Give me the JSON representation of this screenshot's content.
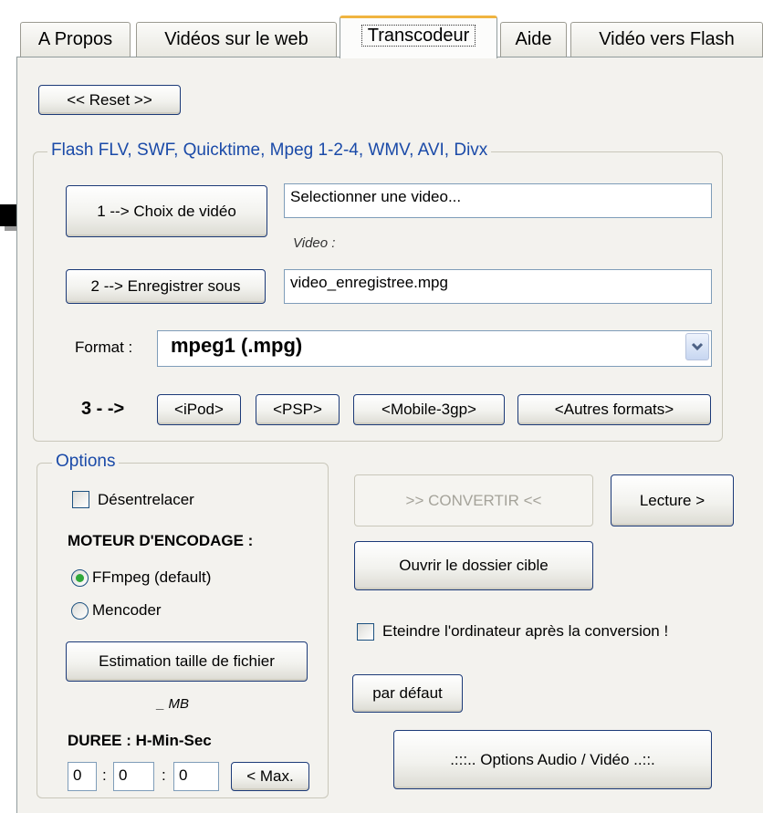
{
  "tabs": [
    {
      "label": "A Propos",
      "active": false
    },
    {
      "label": "Vidéos sur le web",
      "active": false
    },
    {
      "label": "Transcodeur",
      "active": true
    },
    {
      "label": "Aide",
      "active": false
    },
    {
      "label": "Vidéo vers Flash",
      "active": false
    }
  ],
  "reset_button": "<< Reset >>",
  "source_group": {
    "legend": "Flash FLV, SWF, Quicktime, Mpeg 1-2-4, WMV, AVI, Divx",
    "choose_video_button": "1 --> Choix de vidéo",
    "video_path_value": "Selectionner une video...",
    "video_caption": "Video :",
    "save_as_button": "2 --> Enregistrer sous",
    "output_file_value": "video_enregistree.mpg",
    "format_label": "Format :",
    "format_selected": "mpeg1 (.mpg)",
    "preset_label": "3 - ->",
    "presets": [
      "<iPod>",
      "<PSP>",
      "<Mobile-3gp>",
      "<Autres formats>"
    ]
  },
  "options": {
    "legend": "Options",
    "deinterlace_label": "Désentrelacer",
    "deinterlace_checked": false,
    "engine_heading": "MOTEUR D'ENCODAGE :",
    "engines": [
      {
        "label": "FFmpeg (default)",
        "selected": true
      },
      {
        "label": "Mencoder",
        "selected": false
      }
    ],
    "estimate_button": "Estimation taille de fichier",
    "size_value": "_ MB",
    "duration_heading": "DUREE : H-Min-Sec",
    "duration": {
      "h": "0",
      "m": "0",
      "s": "0",
      "sep": ":"
    },
    "max_button": "< Max."
  },
  "actions": {
    "convert_button": ">> CONVERTIR <<",
    "play_button": "Lecture >",
    "open_folder_button": "Ouvrir le dossier cible",
    "shutdown_label": "Eteindre l'ordinateur après la conversion !",
    "shutdown_checked": false,
    "default_button": "par défaut",
    "av_options_button": ".:::.. Options  Audio / Vidéo  ..::."
  },
  "icons": {
    "pointer": "right-arrow-icon",
    "dropdown": "chevron-down-icon"
  }
}
